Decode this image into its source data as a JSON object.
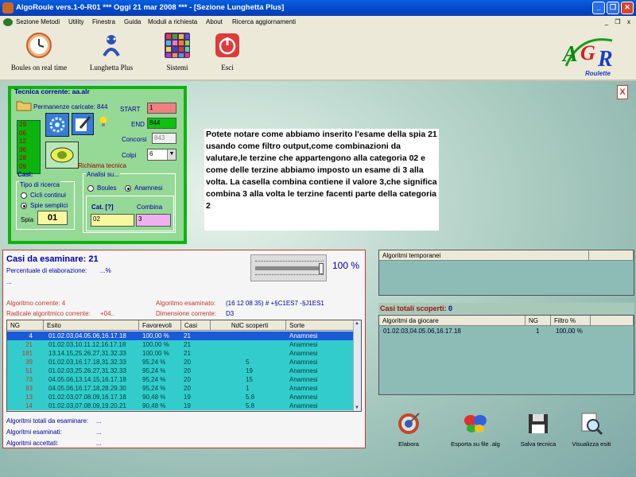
{
  "window": {
    "title": "AlgoRoule vers.1-0-R01  ***  Oggi 21 mar 2008  ***  - [Sezione Lunghetta Plus]",
    "min": "_",
    "max": "❐",
    "close": "✕"
  },
  "menu": [
    "Sezione Metodi",
    "Utility",
    "Finestra",
    "Guida",
    "Moduli a richiesta",
    "About",
    "Ricerca aggiornamenti"
  ],
  "mdi": {
    "min": "_",
    "restore": "❐",
    "close": "x"
  },
  "toolbar": [
    {
      "label": "Boules on real time",
      "icon": "clock-icon",
      "color": "#e07a3a"
    },
    {
      "label": "Lunghetta Plus",
      "icon": "lottery-icon",
      "color": "#2a50c0"
    },
    {
      "label": "Sistemi",
      "icon": "grid-icon",
      "color": "#a03070"
    },
    {
      "label": "Esci",
      "icon": "power-icon",
      "color": "#d02020"
    }
  ],
  "logo": {
    "main": "AGR",
    "sub": "Roulette"
  },
  "close_panel": "X",
  "tecnica": {
    "title": "Tecnica corrente: aa.alr",
    "permanenze": "Permanenze caricate: 844",
    "numbers": [
      "29",
      "06",
      "12",
      "36",
      "28",
      "09"
    ],
    "start_label": "START",
    "start_value": "1",
    "end_label": "END",
    "end_value": "844",
    "concorsi_label": "Concorsi",
    "concorsi_value": "843",
    "colpi_label": "Colpi",
    "colpi_value": "6",
    "richiama": "Richiama tecnica",
    "casi_label": "Casi:",
    "tipo_label": "Tipo di ricerca",
    "ciclo": "Cicli continui",
    "spie": "Spie semplici",
    "spia_label": "Spia",
    "spia_value": "01",
    "analisi_label": "Analisi su...",
    "boules": "Boules",
    "anamnesi": "Anamnesi",
    "cat_label": "Cat. [?]",
    "cat_value": "02",
    "combina_label": "Combina",
    "combina_value": "3"
  },
  "note": "Potete notare come abbiamo inserito l'esame della spia 21 usando come filtro output,come combinazioni da valutare,le terzine che appartengono alla categoria 02 e come delle terzine abbiamo imposto un esame di 3 alla volta. La casella combina contiene il valore 3,che significa combina 3 alla volta le terzine facenti parte della categoria 2",
  "casi": {
    "title": "Casi da esaminare: 21",
    "percent_label": "Percentuale di elaborazione:",
    "percent_value": "...%",
    "dots": "...",
    "progress_text": "100 %",
    "progress": 1.0,
    "alg_corrente": "Algoritmo corrente: 4",
    "radicale_label": "Radicale algoritmico corrente:",
    "radicale_value": "+04..",
    "alg_esaminato_label": "Algoritmo esaminato:",
    "alg_esaminato_value": "(16 12 08 35) # +§C1ES7 -§J1ES1",
    "dimensione_label": "Dimensione corrente:",
    "dimensione_value": "D3",
    "columns": [
      "NG",
      "Esito",
      "Favorevoli",
      "Casi",
      "NdC scoperti",
      "Sorte"
    ],
    "rows": [
      [
        "4",
        "01.02.03,04.05.06,16.17.18",
        "100,00 %",
        "21",
        "",
        "Anamnesi"
      ],
      [
        "21",
        "01.02.03,10.11.12,16.17.18",
        "100,00 %",
        "21",
        "",
        "Anamnesi"
      ],
      [
        "181",
        "13.14.15,25.26.27,31.32.33",
        "100,00 %",
        "21",
        "",
        "Anamnesi"
      ],
      [
        "39",
        "01.02.03,16.17.18,31.32.33",
        "95,24 %",
        "20",
        "5",
        "Anamnesi"
      ],
      [
        "51",
        "01.02.03,25.26.27,31.32.33",
        "95,24 %",
        "20",
        "19",
        "Anamnesi"
      ],
      [
        "73",
        "04.05.06,13.14.15,16.17.18",
        "95,24 %",
        "20",
        "15",
        "Anamnesi"
      ],
      [
        "83",
        "04.05.06,16.17.18,28.29.30",
        "95,24 %",
        "20",
        "1",
        "Anamnesi"
      ],
      [
        "13",
        "01.02.03,07.08.09,16.17.18",
        "90,48 %",
        "19",
        "5.8",
        "Anamnesi"
      ],
      [
        "14",
        "01.02.03,07.08.09,19.20.21",
        "90,48 %",
        "19",
        "5.8",
        "Anamnesi"
      ]
    ],
    "tot_label": "Algoritmi totali da esaminare:",
    "tot_value": "...",
    "esam_label": "Algoritmi esaminati:",
    "esam_value": "...",
    "acc_label": "Algoritmi accettati:",
    "acc_value": "..."
  },
  "alg_temp": {
    "title": "Algoritmi temporanei"
  },
  "casi_totali": {
    "label": "Casi totali scoperti:",
    "value": "0"
  },
  "alg_gioc": {
    "columns": [
      "Algoritmi da giocare",
      "NG",
      "Filtro %"
    ],
    "rows": [
      [
        "01.02.03,04.05.06,16.17.18",
        "1",
        "100,00 %"
      ]
    ]
  },
  "bottom_buttons": [
    {
      "label": "Elabora",
      "icon": "target-icon"
    },
    {
      "label": "Esporta su file .alg",
      "icon": "butterfly-icon"
    },
    {
      "label": "Salva tecnica",
      "icon": "floppy-icon"
    },
    {
      "label": "Visualizza esiti",
      "icon": "magnifier-icon"
    }
  ]
}
